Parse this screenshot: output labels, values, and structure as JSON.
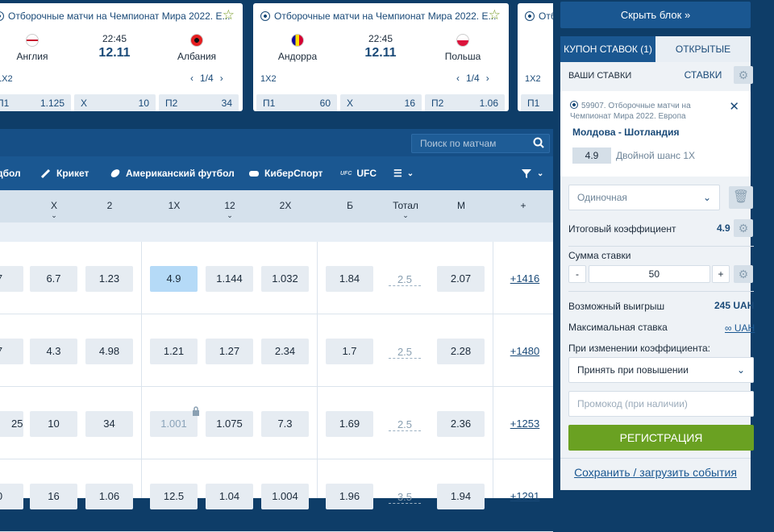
{
  "top_cards": [
    {
      "title": "Отборочные матчи на Чемпионат Мира 2022. Е...",
      "team1": "Англия",
      "team2": "Албания",
      "time": "22:45",
      "date": "12.11",
      "line": "1X2",
      "pager": "1/4",
      "odds": [
        {
          "label": "П1",
          "value": "1.125"
        },
        {
          "label": "X",
          "value": "10"
        },
        {
          "label": "П2",
          "value": "34"
        }
      ]
    },
    {
      "title": "Отборочные матчи на Чемпионат Мира 2022. Е...",
      "team1": "Андорра",
      "team2": "Польша",
      "time": "22:45",
      "date": "12.11",
      "line": "1X2",
      "pager": "1/4",
      "odds": [
        {
          "label": "П1",
          "value": "60"
        },
        {
          "label": "X",
          "value": "16"
        },
        {
          "label": "П2",
          "value": "1.06"
        }
      ]
    },
    {
      "title": "Отб",
      "line": "1X2",
      "odds": [
        {
          "label": "П1",
          "value": ""
        }
      ]
    }
  ],
  "search": {
    "placeholder": "Поиск по матчам"
  },
  "sports": [
    "дбол",
    "Крикет",
    "Американский футбол",
    "КиберСпорт",
    "UFC"
  ],
  "columns": [
    "X",
    "2",
    "1X",
    "12",
    "2X",
    "Б",
    "Тотал",
    "М",
    "+"
  ],
  "rows": [
    {
      "c0": "7",
      "x": "6.7",
      "two": "1.23",
      "x1": "4.9",
      "d12": "1.144",
      "x2": "1.032",
      "b": "1.84",
      "total": "2.5",
      "m": "2.07",
      "more": "+1416"
    },
    {
      "c0": "7",
      "x": "4.3",
      "two": "4.98",
      "x1": "1.21",
      "d12": "1.27",
      "x2": "2.34",
      "b": "1.7",
      "total": "2.5",
      "m": "2.28",
      "more": "+1480"
    },
    {
      "c0": "25",
      "x": "10",
      "two": "34",
      "x1": "1.001",
      "d12": "1.075",
      "x2": "7.3",
      "b": "1.69",
      "total": "2.5",
      "m": "2.36",
      "more": "+1253"
    },
    {
      "c0": "0",
      "x": "16",
      "two": "1.06",
      "x1": "12.5",
      "d12": "1.04",
      "x2": "1.004",
      "b": "1.96",
      "total": "3.5",
      "m": "1.94",
      "more": "+1291"
    }
  ],
  "panel": {
    "hide_label": "Скрыть блок »",
    "tab_coupon": "КУПОН СТАВОК (1)",
    "tab_open": "ОТКРЫТЫЕ СТАВКИ",
    "your_bets": "ВАШИ СТАВКИ",
    "bet_league": "59907. Отборочные матчи на Чемпионат Мира 2022. Европа",
    "bet_match": "Молдова - Шотландия",
    "bet_odd": "4.9",
    "bet_type": "Двойной шанс 1X",
    "bet_kind": "Одиночная",
    "total_coef_label": "Итоговый коэффициент",
    "total_coef": "4.9",
    "stake_label": "Сумма ставки",
    "stake_value": "50",
    "win_label": "Возможный выигрыш",
    "win_value": "245 UAH",
    "max_label": "Максимальная ставка",
    "max_value": "∞ UAH",
    "change_label": "При изменении коэффициента:",
    "change_value": "Принять при повышении",
    "promo_placeholder": "Промокод (при наличии)",
    "register": "РЕГИСТРАЦИЯ",
    "save": "Сохранить / загрузить события"
  }
}
